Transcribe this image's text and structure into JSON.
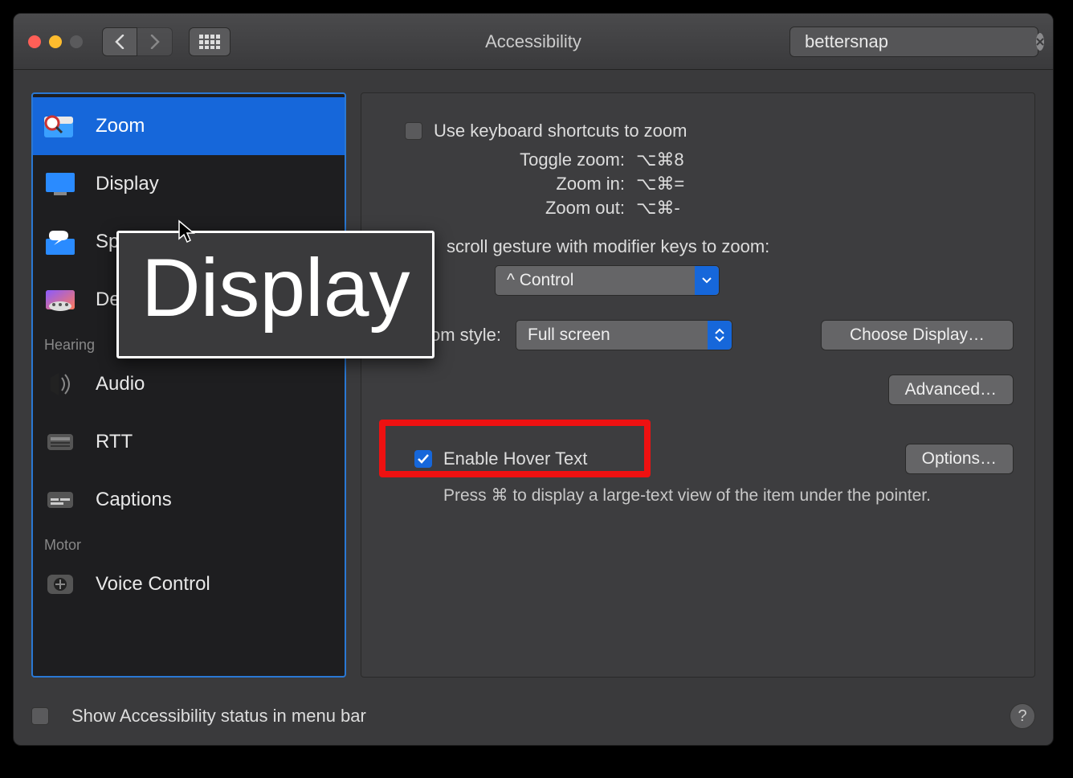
{
  "window": {
    "title": "Accessibility",
    "search_value": "bettersnap"
  },
  "sidebar": {
    "items": [
      {
        "label": "Zoom"
      },
      {
        "label": "Display"
      },
      {
        "label": "Speech"
      },
      {
        "label": "Descriptions"
      }
    ],
    "section_hearing": "Hearing",
    "hearing_items": [
      {
        "label": "Audio"
      },
      {
        "label": "RTT"
      },
      {
        "label": "Captions"
      }
    ],
    "section_motor": "Motor",
    "motor_items": [
      {
        "label": "Voice Control"
      }
    ]
  },
  "content": {
    "keyboard_shortcuts_label": "Use keyboard shortcuts to zoom",
    "shortcuts": [
      {
        "k": "Toggle zoom:",
        "v": "⌥⌘8"
      },
      {
        "k": "Zoom in:",
        "v": "⌥⌘="
      },
      {
        "k": "Zoom out:",
        "v": "⌥⌘-"
      }
    ],
    "scroll_gesture_label": "scroll gesture with modifier keys to zoom:",
    "modifier_value": "^ Control",
    "zoom_style_label": "Zoom style:",
    "zoom_style_value": "Full screen",
    "choose_display_label": "Choose Display…",
    "advanced_label": "Advanced…",
    "hover_text_label": "Enable Hover Text",
    "hover_text_hint": "Press ⌘ to display a large-text view of the item under the pointer.",
    "options_label": "Options…"
  },
  "footer": {
    "status_label": "Show Accessibility status in menu bar"
  },
  "hover_tooltip": "Display"
}
